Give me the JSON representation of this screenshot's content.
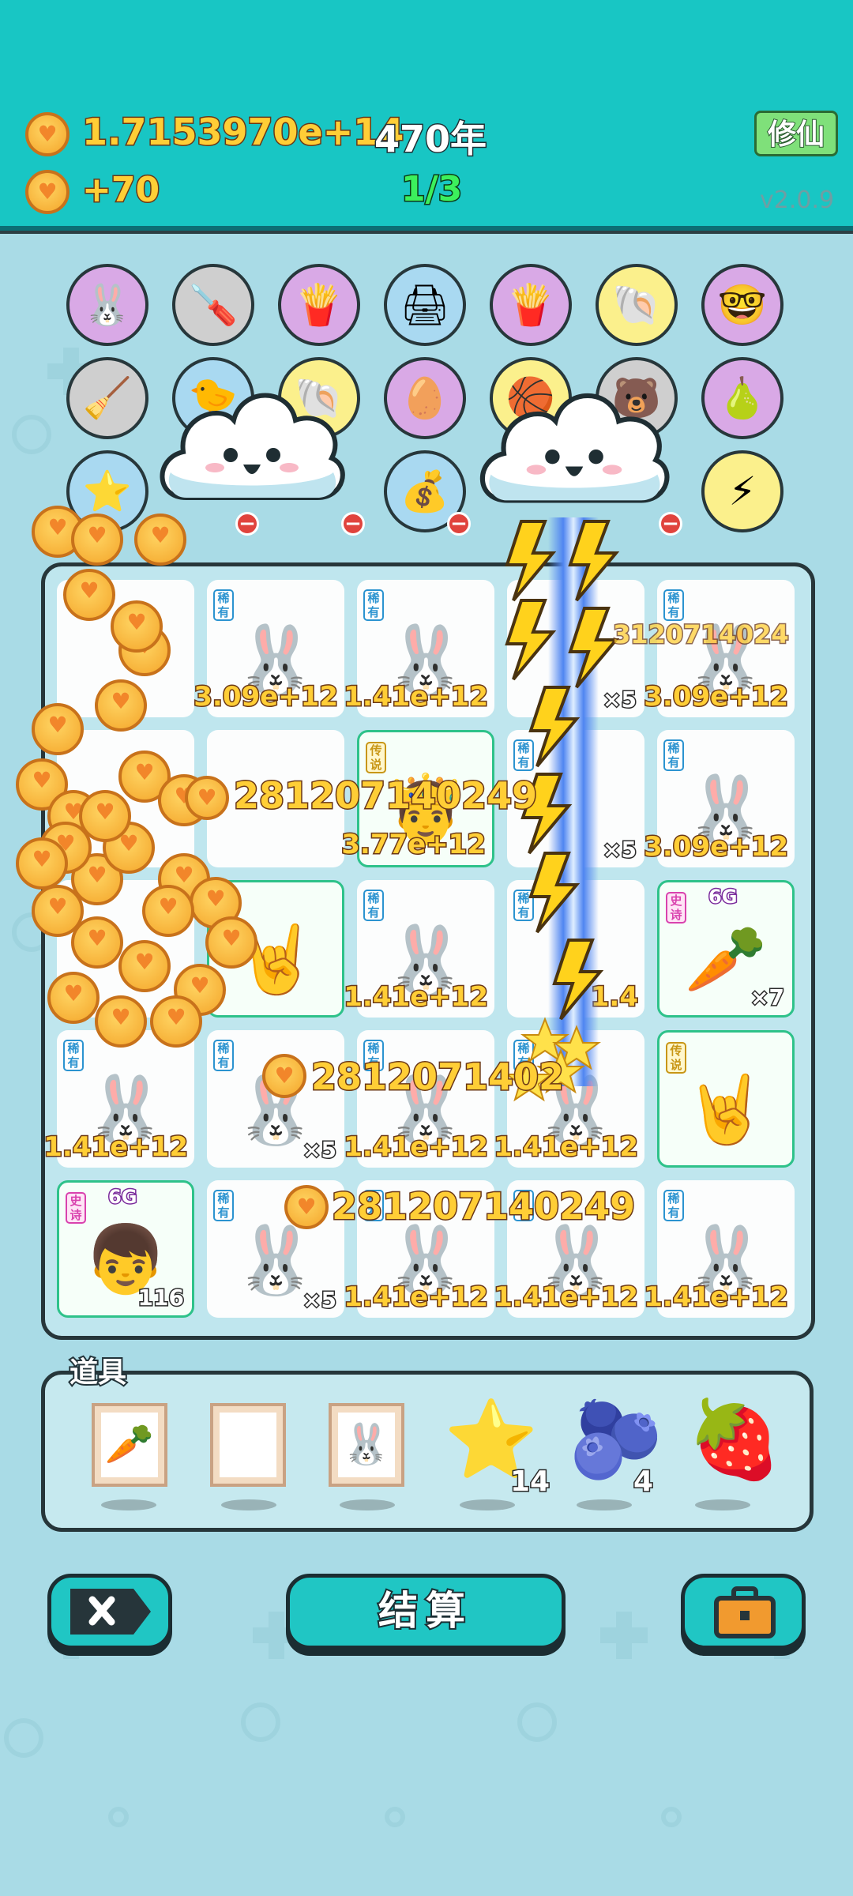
{
  "header": {
    "money": "1.7153970e+14",
    "year": "470年",
    "rate": "+70",
    "page_counter": "1/3",
    "xiuxian_label": "修仙",
    "version": "v2.0.9"
  },
  "items_row1": [
    "bunny",
    "screwdriver",
    "fries",
    "printer",
    "fries",
    "shell",
    "glasses-face"
  ],
  "items_row2": [
    "broom",
    "chick",
    "shell",
    "egg",
    "basketball",
    "bear",
    "guava"
  ],
  "items_row3": [
    "star",
    "",
    "",
    "money-bag",
    "",
    "",
    "lightning"
  ],
  "floating_numbers": [
    "281207140249",
    "2812071402",
    "281207140249",
    "3120714024"
  ],
  "board": {
    "tags": {
      "rare": "稀有",
      "legend": "传说",
      "epic": "史诗"
    },
    "cells": [
      {
        "tag": "",
        "value": "",
        "count": ""
      },
      {
        "tag": "稀有",
        "value": "3.09e+12",
        "count": ""
      },
      {
        "tag": "稀有",
        "value": "1.41e+12",
        "count": ""
      },
      {
        "tag": "",
        "value": "",
        "count": "×5"
      },
      {
        "tag": "稀有",
        "value": "3.09e+12",
        "count": ""
      },
      {
        "tag": "",
        "value": "",
        "count": ""
      },
      {
        "tag": "",
        "value": "",
        "count": ""
      },
      {
        "tag": "传说",
        "value": "3.77e+12",
        "count": ""
      },
      {
        "tag": "稀有",
        "value": "",
        "count": "×5"
      },
      {
        "tag": "稀有",
        "value": "3.09e+12",
        "count": ""
      },
      {
        "tag": "",
        "value": "",
        "count": ""
      },
      {
        "tag": "",
        "value": "",
        "count": ""
      },
      {
        "tag": "稀有",
        "value": "1.41e+12",
        "count": ""
      },
      {
        "tag": "稀有",
        "value": "1.4",
        "count": ""
      },
      {
        "tag": "史诗",
        "value": "",
        "count": "×7"
      },
      {
        "tag": "稀有",
        "value": "1.41e+12",
        "count": ""
      },
      {
        "tag": "稀有",
        "value": "",
        "count": "×5"
      },
      {
        "tag": "稀有",
        "value": "1.41e+12",
        "count": ""
      },
      {
        "tag": "稀有",
        "value": "1.41e+12",
        "count": ""
      },
      {
        "tag": "传说",
        "value": "",
        "count": ""
      },
      {
        "tag": "史诗",
        "value": "",
        "count": "116"
      },
      {
        "tag": "稀有",
        "value": "",
        "count": "×5"
      },
      {
        "tag": "稀有",
        "value": "1.41e+12",
        "count": ""
      },
      {
        "tag": "稀有",
        "value": "1.41e+12",
        "count": ""
      },
      {
        "tag": "稀有",
        "value": "1.41e+12",
        "count": ""
      }
    ],
    "badge_6g": "6G"
  },
  "props": {
    "title": "道具",
    "star_count": "14",
    "berry_count": "4"
  },
  "buttons": {
    "settle_label": "结算"
  },
  "colors": {
    "header_bg": "#18c6c4",
    "page_bg": "#a9dbe6",
    "gold_text": "#ffce36",
    "counter_green": "#3cf05c"
  }
}
